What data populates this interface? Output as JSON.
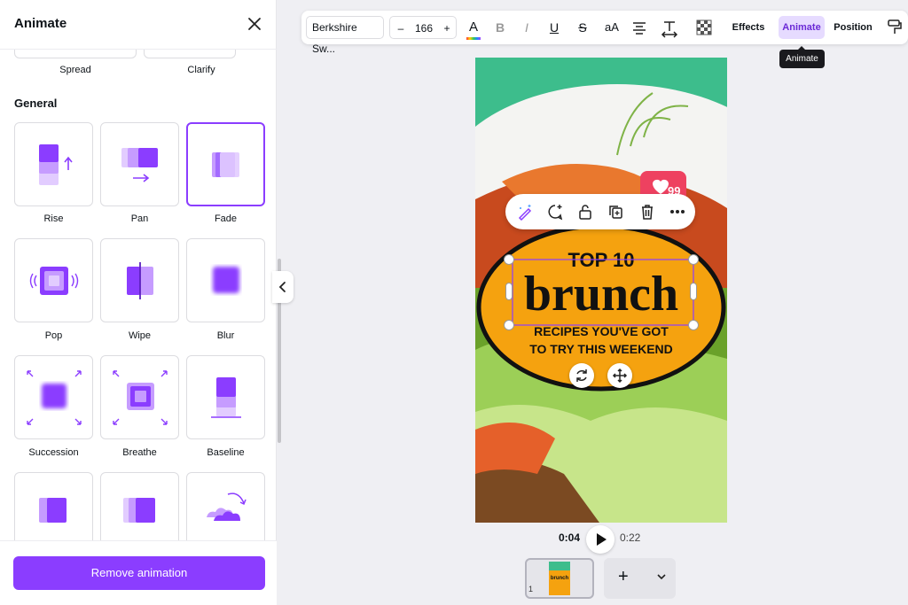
{
  "panel": {
    "title": "Animate",
    "prev_labels": [
      "Spread",
      "Clarify"
    ],
    "section_title": "General",
    "cards": [
      {
        "label": "Rise",
        "icon": "rise-icon"
      },
      {
        "label": "Pan",
        "icon": "pan-icon"
      },
      {
        "label": "Fade",
        "icon": "fade-icon",
        "selected": true
      },
      {
        "label": "Pop",
        "icon": "pop-icon"
      },
      {
        "label": "Wipe",
        "icon": "wipe-icon"
      },
      {
        "label": "Blur",
        "icon": "blur-icon"
      },
      {
        "label": "Succession",
        "icon": "succession-icon"
      },
      {
        "label": "Breathe",
        "icon": "breathe-icon"
      },
      {
        "label": "Baseline",
        "icon": "baseline-icon"
      }
    ],
    "remove_label": "Remove animation"
  },
  "toolbar": {
    "font": "Berkshire Sw...",
    "font_size": "166",
    "minus": "–",
    "plus": "+",
    "text_color_glyph": "A",
    "bold": "B",
    "italic": "I",
    "underline": "U",
    "strike": "S",
    "case": "aA",
    "effects": "Effects",
    "animate": "Animate",
    "position": "Position"
  },
  "tooltip": "Animate",
  "design": {
    "line1": "TOP 10",
    "line2": "brunch",
    "line3": "RECIPES YOU'VE GOT",
    "line4": "TO TRY THIS WEEKEND",
    "likes": "99"
  },
  "playback": {
    "current": "0:04",
    "total": "0:22"
  },
  "pages": {
    "thumb_number": "1",
    "thumb_text": "brunch",
    "add": "+"
  },
  "colors": {
    "accent": "#8b3dff",
    "orange": "#f5a20f",
    "teal": "#3dbd8c"
  }
}
